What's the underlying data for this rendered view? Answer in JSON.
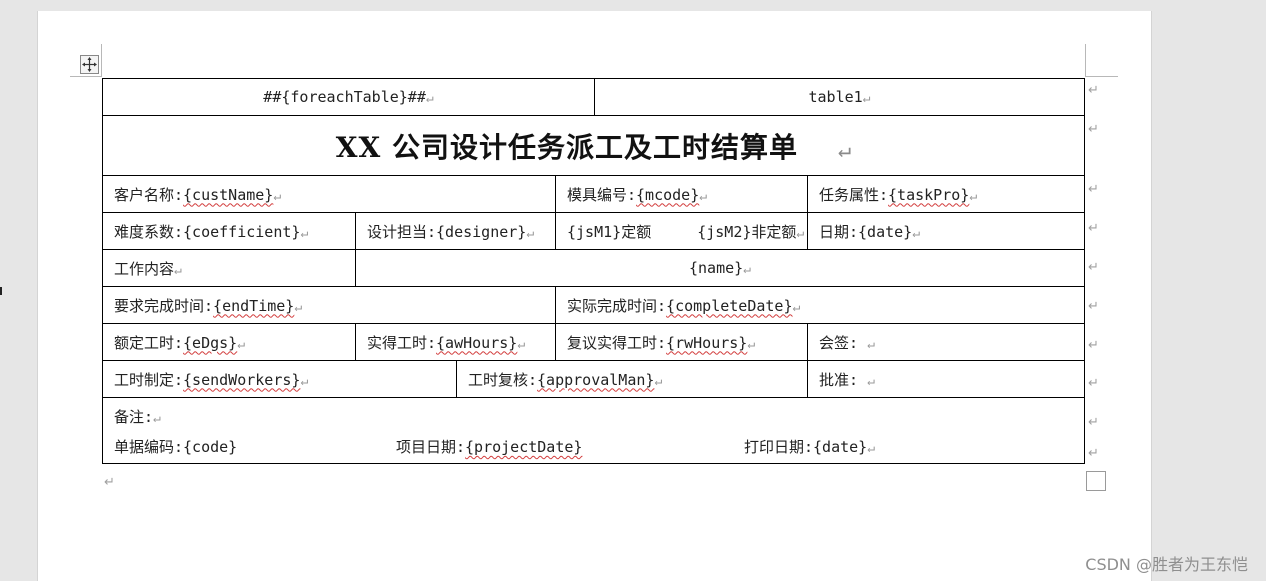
{
  "marks": {
    "paragraph": "↵"
  },
  "table": {
    "header_left": "##{foreachTable}##",
    "header_right": "table1",
    "title": "XX 公司设计任务派工及工时结算单",
    "row1": {
      "cust_label": "客户名称:",
      "cust_value": "{custName}",
      "mold_label": "模具编号:",
      "mold_value": "{mcode}",
      "task_label": "任务属性:",
      "task_value": "{taskPro}"
    },
    "row2": {
      "coef_label": "难度系数:",
      "coef_value": "{coefficient}",
      "designer_label": "设计担当:",
      "designer_value": "{designer}",
      "js1_value": "{jsM1}",
      "js1_label": "定额",
      "js2_value": "{jsM2}",
      "js2_label": "非定额",
      "date_label": "日期:",
      "date_value": "{date}"
    },
    "row3": {
      "work_label": "工作内容",
      "name_value": "{name}"
    },
    "row4": {
      "end_label": "要求完成时间:",
      "end_value": "{endTime}",
      "complete_label": "实际完成时间:",
      "complete_value": "{completeDate}"
    },
    "row5": {
      "quota_label": "额定工时:",
      "quota_value": "{eDgs}",
      "actual_label": "实得工时:",
      "actual_value": "{awHours}",
      "review_label": "复议实得工时:",
      "review_value": "{rwHours}",
      "sign_label": "会签:"
    },
    "row6": {
      "make_label": "工时制定:",
      "make_value": "{sendWorkers}",
      "check_label": "工时复核:",
      "check_value": "{approvalMan}",
      "approve_label": "批准:"
    },
    "notes": {
      "remark_label": "备注:",
      "code_label": "单据编码:",
      "code_value": "{code}",
      "project_label": "项目日期:",
      "project_value": "{projectDate}",
      "print_label": "打印日期:",
      "print_value": "{date}"
    }
  },
  "watermark": "CSDN @胜者为王东恺"
}
